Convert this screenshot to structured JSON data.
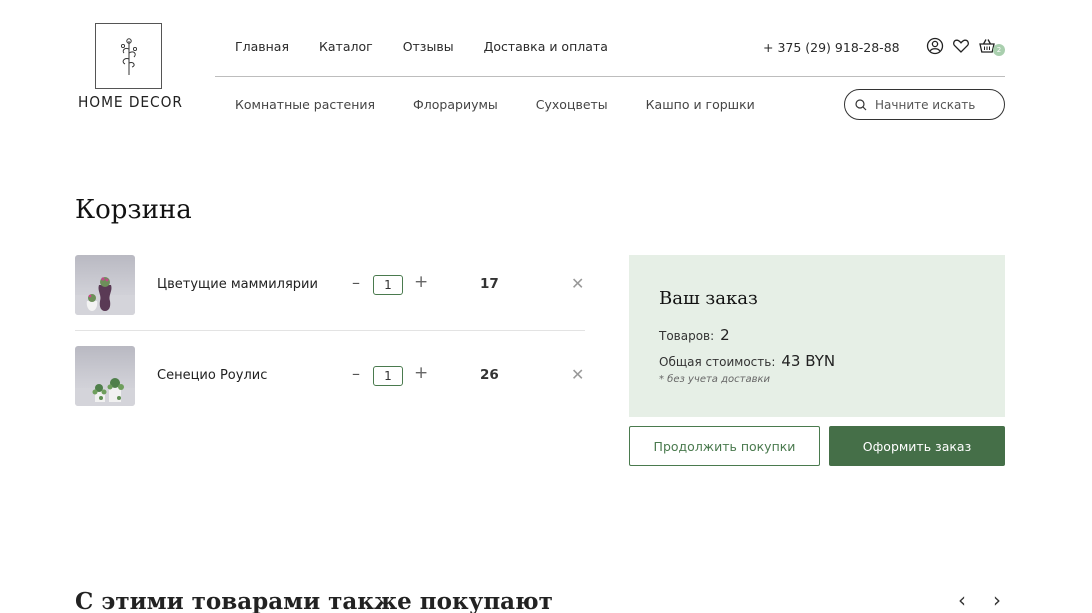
{
  "brand": {
    "name": "HOME DECOR"
  },
  "header": {
    "top_nav": [
      "Главная",
      "Каталог",
      "Отзывы",
      "Доставка и оплата"
    ],
    "phone": "+ 375 (29) 918-28-88",
    "cart_count": "2",
    "icons": [
      "user-icon",
      "heart-icon",
      "basket-icon"
    ],
    "sub_nav": [
      "Комнатные растения",
      "Флорариумы",
      "Сухоцветы",
      "Кашпо и горшки"
    ],
    "search": {
      "placeholder": "Начните искать",
      "value": ""
    }
  },
  "page": {
    "title": "Корзина"
  },
  "cart": {
    "items": [
      {
        "name": "Цветущие маммилярии",
        "qty": "1",
        "price": "17",
        "minus": "–",
        "plus": "+",
        "remove": "✕"
      },
      {
        "name": "Сенецио Роулис",
        "qty": "1",
        "price": "26",
        "minus": "–",
        "plus": "+",
        "remove": "✕"
      }
    ]
  },
  "summary": {
    "title": "Ваш заказ",
    "items_label": "Товаров:",
    "items_count": "2",
    "total_label": "Общая стоимость:",
    "total_value": "43 BYN",
    "note": "* без учета доставки",
    "continue_label": "Продолжить покупки",
    "order_label": "Оформить заказ"
  },
  "related": {
    "title": "С этими товарами также покупают",
    "prev": "‹",
    "next": "›"
  },
  "colors": {
    "accent": "#456f48",
    "summary_bg": "#e6efe6",
    "badge": "#a9cfae"
  }
}
